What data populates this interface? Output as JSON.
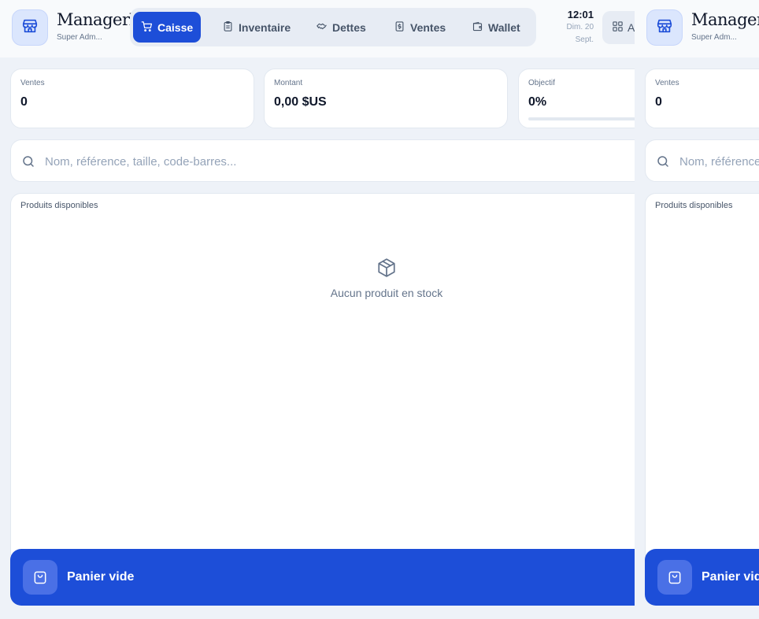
{
  "brand": {
    "name": "ManagerX",
    "role": "Super Adm..."
  },
  "nav": {
    "items": [
      {
        "label": "Caisse",
        "icon": "cart-icon",
        "active": true
      },
      {
        "label": "Inventaire",
        "icon": "clipboard-icon",
        "active": false
      },
      {
        "label": "Dettes",
        "icon": "handshake-icon",
        "active": false
      },
      {
        "label": "Ventes",
        "icon": "dollar-icon",
        "active": false
      },
      {
        "label": "Wallet",
        "icon": "wallet-icon",
        "active": false
      }
    ]
  },
  "clock": {
    "time": "12:01",
    "date_line1": "Dim. 20",
    "date_line2": "Sept."
  },
  "apps_button": {
    "label": "A",
    "icon": "grid-icon"
  },
  "stats": {
    "sales": {
      "label": "Ventes",
      "value": "0"
    },
    "amount": {
      "label": "Montant",
      "value": "0,00 $US"
    },
    "goal": {
      "label": "Objectif",
      "value": "0%",
      "progress": 0
    }
  },
  "search": {
    "placeholder": "Nom, référence, taille, code-barres...",
    "value": ""
  },
  "products": {
    "title": "Produits disponibles",
    "empty_text": "Aucun produit en stock",
    "empty_icon": "package-icon"
  },
  "cart": {
    "label": "Panier vide",
    "icon": "shopping-bag-icon"
  },
  "colors": {
    "primary": "#1d4ed8",
    "background": "#eef2f8",
    "card": "#ffffff"
  }
}
